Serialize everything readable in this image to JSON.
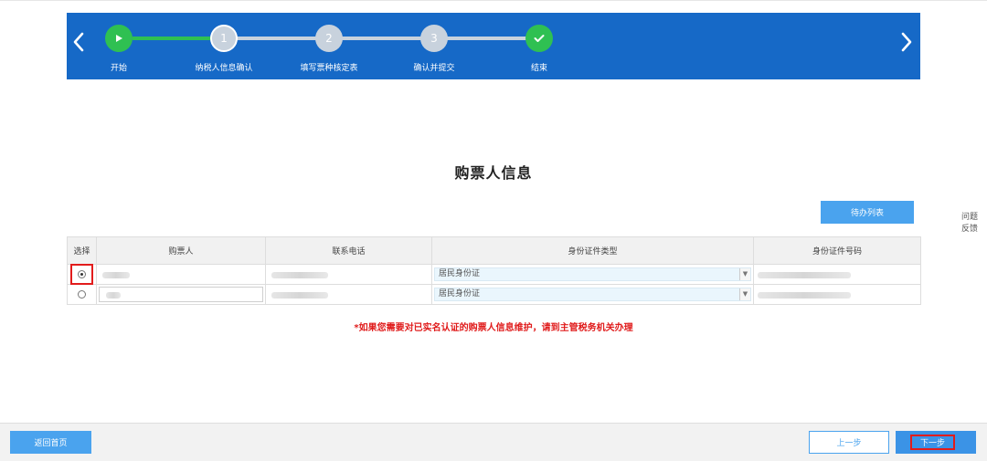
{
  "progress": {
    "steps": [
      {
        "label": "开始",
        "number": "",
        "state": "done"
      },
      {
        "label": "纳税人信息确认",
        "number": "1",
        "state": "current"
      },
      {
        "label": "填写票种核定表",
        "number": "2",
        "state": "pending"
      },
      {
        "label": "确认并提交",
        "number": "3",
        "state": "pending"
      },
      {
        "label": "结束",
        "number": "",
        "state": "final"
      }
    ],
    "colors": {
      "banner": "#1669c7",
      "done": "#2fc052",
      "pending": "#c8d2dd"
    }
  },
  "main": {
    "title": "购票人信息",
    "pending_list_label": "待办列表",
    "notice": "*如果您需要对已实名认证的购票人信息维护，请到主管税务机关办理"
  },
  "table": {
    "headers": {
      "select": "选择",
      "buyer": "购票人",
      "phone": "联系电话",
      "id_type": "身份证件类型",
      "id_number": "身份证件号码"
    },
    "rows": [
      {
        "selected": true,
        "id_type": "居民身份证"
      },
      {
        "selected": false,
        "id_type": "居民身份证"
      }
    ]
  },
  "feedback": {
    "line1": "问题",
    "line2": "反馈"
  },
  "footer": {
    "home_label": "返回首页",
    "prev_label": "上一步",
    "next_label": "下一步"
  }
}
